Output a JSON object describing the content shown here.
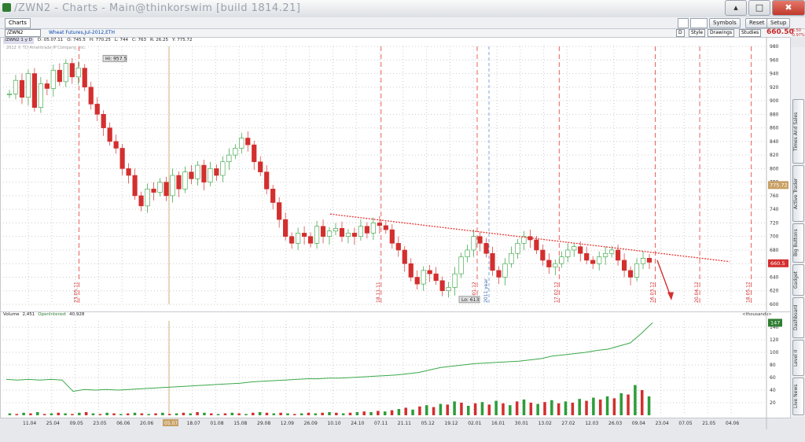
{
  "window": {
    "title": "/ZWN2 - Charts - Main@thinkorswim [build 1814.21]",
    "controls": [
      "▴",
      "□",
      "✖"
    ]
  },
  "toolbar": {
    "tab_label": "Charts",
    "buttons": [
      "Symbols",
      "Reset",
      "Setup"
    ]
  },
  "symbolbar": {
    "symbol": "/ZWN2",
    "period": "1 y D",
    "description": "Wheat Futures,Jul-2012,ETH",
    "buttons": [
      "D",
      "Style",
      "Drawings",
      "Studies"
    ],
    "last_price": "660.50",
    "change": "-6.50",
    "change_pct": "-0.97%"
  },
  "ohlc_header": {
    "symbol": "/ZWN2 1 y D",
    "d": "D: 05.07.11",
    "o": "O: 745.5",
    "h": "H: 770.25",
    "l": "L: 744",
    "c": "C: 763",
    "r": "R: 26.25",
    "y": "Y: 775.72"
  },
  "copyright": "2012 © TD Ameritrade IP Company, Inc.",
  "volume_header": {
    "label": "Volume",
    "value": "2,451",
    "oi_label": "OpenInterest",
    "oi_value": "40,928",
    "units": "<thousands>"
  },
  "sidebar_tabs": [
    "Live News",
    "Level II",
    "Dashboard",
    "Gadget",
    "Big Buttons",
    "Active Trader",
    "Times And Sales"
  ],
  "chart_data": {
    "type": "line",
    "title": "",
    "price_axis": {
      "min": 600,
      "max": 980,
      "ticks": [
        600,
        620,
        640,
        660,
        680,
        700,
        720,
        740,
        760,
        780,
        800,
        820,
        840,
        860,
        880,
        900,
        920,
        940,
        960,
        980
      ],
      "cursor_label": "775.72",
      "last_label": "660.5"
    },
    "volume_axis": {
      "min": 0,
      "max": 150,
      "ticks": [
        20,
        40,
        60,
        80,
        100,
        120,
        140
      ],
      "last_label": "147"
    },
    "x_ticks": [
      "11.04",
      "25.04",
      "09.05",
      "23.05",
      "06.06",
      "20.06",
      "05.07",
      "18.07",
      "01.08",
      "15.08",
      "29.08",
      "12.09",
      "26.09",
      "10.10",
      "24.10",
      "07.11",
      "21.11",
      "05.12",
      "19.12",
      "02.01",
      "16.01",
      "30.01",
      "13.02",
      "27.02",
      "12.03",
      "26.03",
      "09.04",
      "23.04",
      "07.05",
      "21.05",
      "04.06"
    ],
    "cursor_date": "05.07",
    "annotations": {
      "high": "Hi: 957.5",
      "low": "Lo: 613",
      "year_marker": "2011 year"
    },
    "vertical_lines": [
      "23.05.11",
      "18.11.11",
      "20.01.12",
      "17.02.12",
      "16.03.12",
      "20.04.12",
      "18.05.12"
    ],
    "trendline": {
      "from": [
        "10.10",
        733
      ],
      "to": [
        "30.04",
        663
      ]
    },
    "price_close": [
      910,
      930,
      905,
      940,
      890,
      925,
      918,
      945,
      928,
      955,
      935,
      948,
      920,
      895,
      880,
      860,
      840,
      830,
      800,
      790,
      760,
      745,
      770,
      765,
      780,
      760,
      790,
      770,
      795,
      785,
      805,
      780,
      800,
      790,
      810,
      820,
      830,
      845,
      835,
      810,
      795,
      770,
      750,
      725,
      700,
      690,
      705,
      700,
      690,
      715,
      700,
      708,
      712,
      700,
      705,
      700,
      715,
      705,
      720,
      716,
      710,
      690,
      680,
      660,
      640,
      630,
      650,
      645,
      635,
      620,
      625,
      645,
      670,
      680,
      700,
      690,
      675,
      650,
      640,
      660,
      675,
      690,
      700,
      695,
      680,
      665,
      655,
      660,
      670,
      680,
      685,
      675,
      665,
      660,
      670,
      675,
      680,
      665,
      650,
      640,
      660,
      668,
      662
    ],
    "open_interest": [
      57,
      56,
      57,
      56,
      57,
      56,
      38,
      41,
      40,
      41,
      40,
      41,
      42,
      43,
      44,
      45,
      46,
      47,
      48,
      49,
      50,
      51,
      53,
      54,
      55,
      56,
      57,
      58,
      58,
      59,
      59,
      60,
      61,
      62,
      63,
      64,
      66,
      68,
      72,
      76,
      78,
      80,
      82,
      83,
      84,
      85,
      86,
      88,
      90,
      94,
      96,
      98,
      100,
      103,
      105,
      110,
      115,
      130,
      147
    ],
    "volume_bars": [
      3,
      2,
      4,
      3,
      5,
      2,
      3,
      4,
      3,
      2,
      4,
      5,
      3,
      2,
      4,
      3,
      2,
      3,
      4,
      3,
      2,
      3,
      4,
      2,
      3,
      4,
      3,
      5,
      4,
      3,
      2,
      3,
      4,
      3,
      2,
      4,
      5,
      4,
      3,
      4,
      3,
      2,
      3,
      4,
      3,
      4,
      5,
      4,
      3,
      4,
      5,
      6,
      5,
      7,
      6,
      8,
      10,
      12,
      9,
      14,
      16,
      13,
      18,
      17,
      22,
      20,
      15,
      19,
      21,
      17,
      23,
      19,
      16,
      22,
      25,
      20,
      18,
      21,
      24,
      19,
      22,
      20,
      26,
      23,
      28,
      25,
      30,
      27,
      35,
      33,
      48,
      40,
      30
    ]
  }
}
